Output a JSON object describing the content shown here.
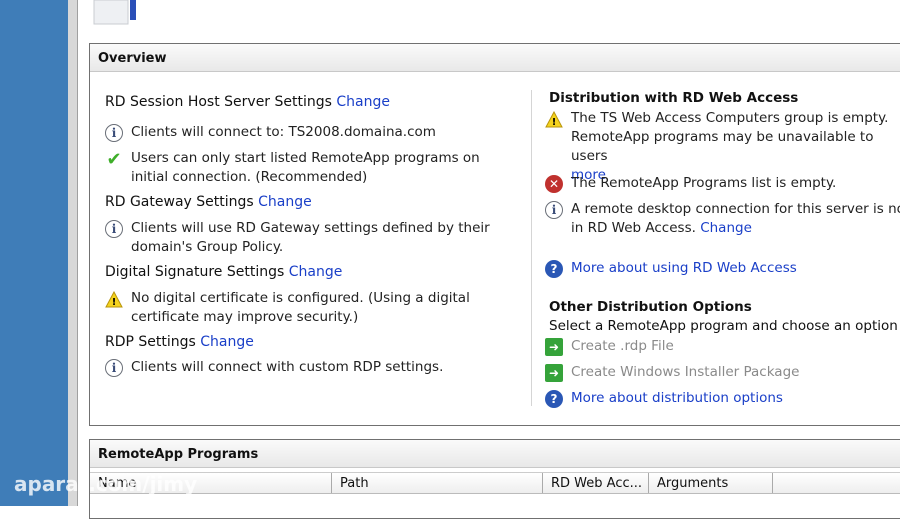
{
  "overview": {
    "title": "Overview",
    "left": [
      {
        "heading": "RD Session Host Server Settings",
        "change": "Change",
        "items": [
          {
            "icon": "info-icon",
            "text": "Clients will connect to: TS2008.domaina.com"
          },
          {
            "icon": "checkmark-icon",
            "text": "Users can only start listed RemoteApp programs on initial connection. (Recommended)"
          }
        ]
      },
      {
        "heading": "RD Gateway Settings",
        "change": "Change",
        "items": [
          {
            "icon": "info-icon",
            "text": "Clients will use RD Gateway settings defined by their domain's Group Policy."
          }
        ]
      },
      {
        "heading": "Digital Signature Settings",
        "change": "Change",
        "items": [
          {
            "icon": "warning-icon",
            "text": "No digital certificate is configured. (Using a digital certificate may improve security.)"
          }
        ]
      },
      {
        "heading": "RDP Settings",
        "change": "Change",
        "items": [
          {
            "icon": "info-icon",
            "text": "Clients will connect with custom RDP settings."
          }
        ]
      }
    ],
    "distribution": {
      "heading": "Distribution with RD Web Access",
      "warning": "The TS Web Access Computers group is empty. RemoteApp programs may be unavailable to users",
      "more": "more",
      "error": "The RemoteApp Programs list is empty.",
      "info": "A remote desktop connection for this server is not",
      "info2": "in RD Web Access.",
      "change": "Change",
      "help": "More about using RD Web Access"
    },
    "other": {
      "heading": "Other Distribution Options",
      "desc": "Select a RemoteApp program and choose an option b",
      "rdp": "Create .rdp File",
      "msi": "Create Windows Installer Package",
      "help": "More about distribution options"
    }
  },
  "programs": {
    "title": "RemoteApp Programs",
    "columns": [
      "Name",
      "Path",
      "RD Web Acc...",
      "Arguments"
    ]
  },
  "watermark": "aparat.com/jimy"
}
